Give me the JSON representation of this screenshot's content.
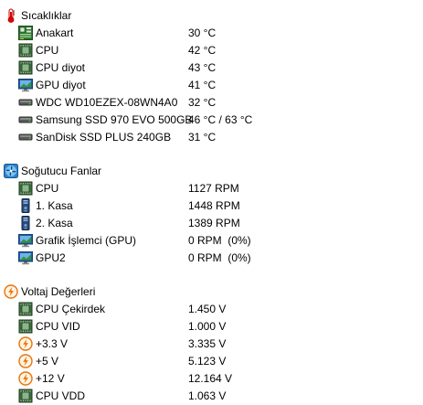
{
  "sections": [
    {
      "title": "Sıcaklıklar",
      "icon": "thermometer-icon",
      "items": [
        {
          "label": "Anakart",
          "value": "30 °C",
          "icon": "motherboard-icon"
        },
        {
          "label": "CPU",
          "value": "42 °C",
          "icon": "cpu-chip-icon"
        },
        {
          "label": "CPU diyot",
          "value": "43 °C",
          "icon": "cpu-chip-icon"
        },
        {
          "label": "GPU diyot",
          "value": "41 °C",
          "icon": "monitor-icon"
        },
        {
          "label": "WDC WD10EZEX-08WN4A0",
          "value": "32 °C",
          "icon": "hard-drive-icon"
        },
        {
          "label": "Samsung SSD 970 EVO 500GB",
          "value": "46 °C / 63 °C",
          "icon": "hard-drive-icon"
        },
        {
          "label": "SanDisk SSD PLUS 240GB",
          "value": "31 °C",
          "icon": "hard-drive-icon"
        }
      ]
    },
    {
      "title": "Soğutucu Fanlar",
      "icon": "fan-icon",
      "items": [
        {
          "label": "CPU",
          "value": "1127 RPM",
          "icon": "cpu-chip-icon"
        },
        {
          "label": "1. Kasa",
          "value": "1448 RPM",
          "icon": "pc-case-icon"
        },
        {
          "label": "2. Kasa",
          "value": "1389 RPM",
          "icon": "pc-case-icon"
        },
        {
          "label": "Grafik İşlemci (GPU)",
          "value": "0 RPM  (0%)",
          "icon": "monitor-icon"
        },
        {
          "label": "GPU2",
          "value": "0 RPM  (0%)",
          "icon": "monitor-icon"
        }
      ]
    },
    {
      "title": "Voltaj Değerleri",
      "icon": "voltage-icon",
      "items": [
        {
          "label": "CPU Çekirdek",
          "value": "1.450 V",
          "icon": "cpu-chip-icon"
        },
        {
          "label": "CPU VID",
          "value": "1.000 V",
          "icon": "cpu-chip-icon"
        },
        {
          "label": "+3.3 V",
          "value": "3.335 V",
          "icon": "voltage-icon"
        },
        {
          "label": "+5 V",
          "value": "5.123 V",
          "icon": "voltage-icon"
        },
        {
          "label": "+12 V",
          "value": "12.164 V",
          "icon": "voltage-icon"
        },
        {
          "label": "CPU VDD",
          "value": "1.063 V",
          "icon": "cpu-chip-icon"
        }
      ]
    }
  ]
}
